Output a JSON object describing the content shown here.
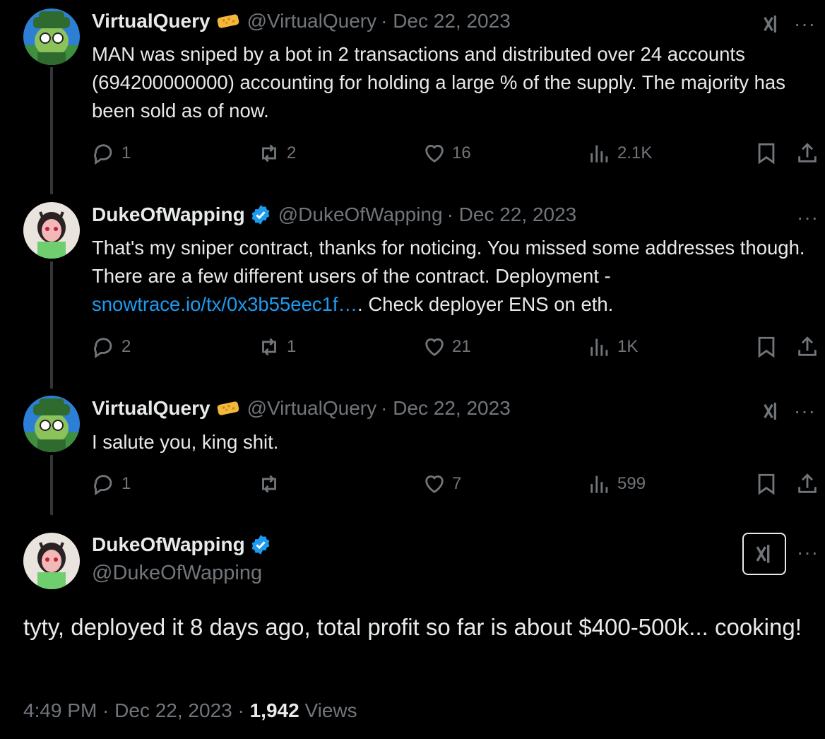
{
  "thread": [
    {
      "name": "VirtualQuery",
      "handle": "@VirtualQuery",
      "date": "· Dec 22, 2023",
      "text": "MAN was sniped by a bot in 2 transactions and distributed over 24 accounts (694200000000) accounting for holding a large % of the supply. The majority has been sold as of now.",
      "replies": "1",
      "reposts": "2",
      "likes": "16",
      "views": "2.1K"
    },
    {
      "name": "DukeOfWapping",
      "handle": "@DukeOfWapping",
      "date": "· Dec 22, 2023",
      "text_before": "That's my sniper contract, thanks for noticing. You missed some addresses though. There are a few different users of the contract. Deployment -",
      "link": "snowtrace.io/tx/0x3b55eec1f…",
      "text_after": ". Check deployer ENS on eth.",
      "replies": "2",
      "reposts": "1",
      "likes": "21",
      "views": "1K"
    },
    {
      "name": "VirtualQuery",
      "handle": "@VirtualQuery",
      "date": "· Dec 22, 2023",
      "text": "I salute you, king shit.",
      "replies": "1",
      "reposts": "",
      "likes": "7",
      "views": "599"
    }
  ],
  "main_tweet": {
    "name": "DukeOfWapping",
    "handle": "@DukeOfWapping",
    "text": "tyty, deployed it 8 days ago, total profit so far is about $400-500k... cooking!",
    "time": "4:49 PM · Dec 22, 2023 ·",
    "views_count": "1,942",
    "views_label": "Views"
  },
  "more_label": "···",
  "icons": {
    "reply": "reply-icon",
    "repost": "repost-icon",
    "like": "heart-icon",
    "views": "analytics-icon",
    "bookmark": "bookmark-icon",
    "share": "share-icon",
    "verified": "verified-badge-icon",
    "grok": "grok-icon",
    "sponge": "sponge-emoji-icon"
  },
  "colors": {
    "background": "#000000",
    "text": "#e7e9ea",
    "muted": "#71767b",
    "link": "#1d9bf0",
    "verified": "#1d9bf0"
  }
}
